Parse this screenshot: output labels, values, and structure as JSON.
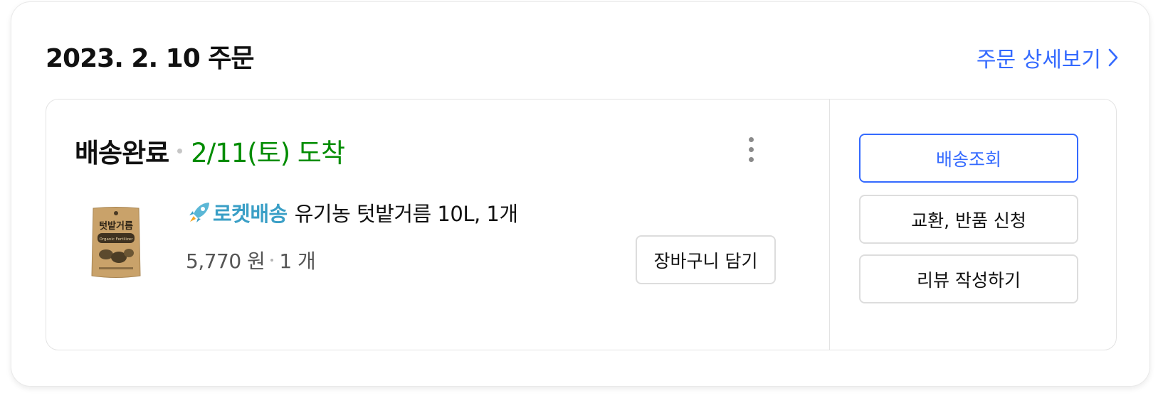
{
  "order": {
    "date_title": "2023. 2. 10 주문",
    "detail_link_label": "주문 상세보기"
  },
  "shipment": {
    "status": "배송완료",
    "arrival": "2/11(토) 도착",
    "product": {
      "badge_label": "로켓배송",
      "name": "유기농 텃밭거름 10L, 1개",
      "price": "5,770 원",
      "quantity": "1 개",
      "thumbnail_text": "텃밭거름",
      "thumbnail_subtext": "Organic Fertilizer"
    },
    "add_to_cart_label": "장바구니 담기"
  },
  "actions": {
    "track_label": "배송조회",
    "return_label": "교환, 반품 신청",
    "review_label": "리뷰 작성하기"
  },
  "colors": {
    "accent_blue": "#346aff",
    "arrival_green": "#008c00",
    "rocket_teal": "#3a9fc6"
  },
  "icons": [
    "chevron-right-icon",
    "more-vertical-icon",
    "rocket-icon"
  ]
}
